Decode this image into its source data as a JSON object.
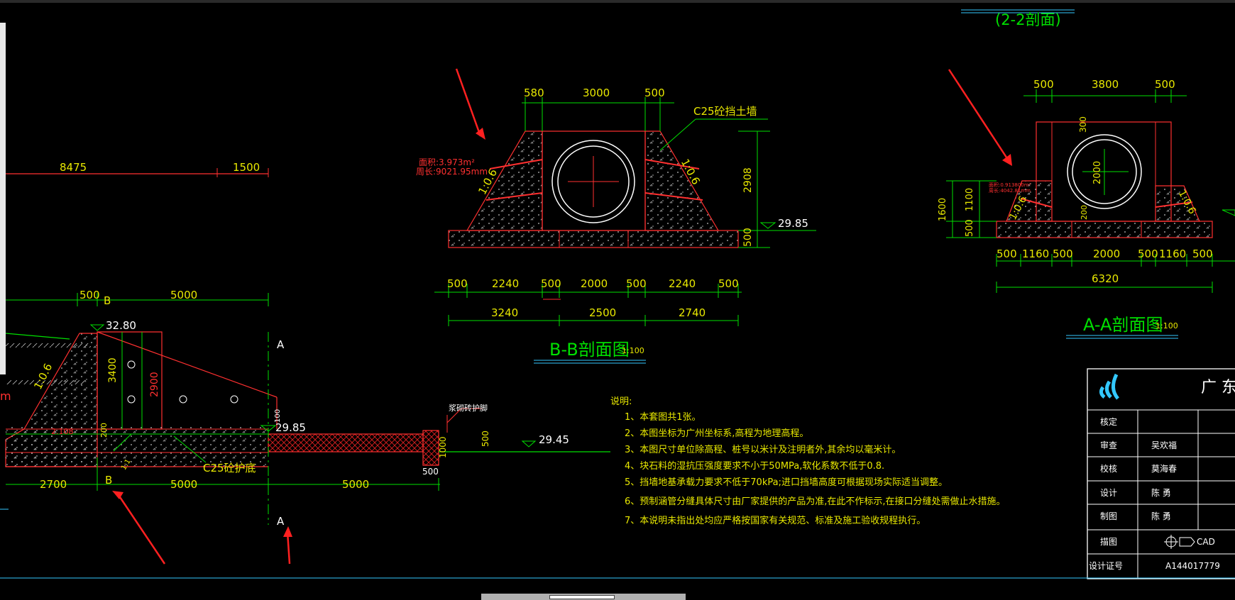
{
  "drawing": {
    "top_dims": {
      "d8475": "8475",
      "d1500": "1500"
    },
    "left": {
      "d500": "500",
      "labelB_top": "B",
      "d5000_top": "5000",
      "elev_3280": "32.80",
      "d3400": "3400",
      "d2900": "2900",
      "slope": "1:0.6",
      "d200": "200",
      "d2108": "2.108",
      "d100": "100",
      "elev_2985": "29.85",
      "labelA_top": "A",
      "labelA_bottom": "A",
      "d2700": "2700",
      "labelB_bottom": "B",
      "d5000_a": "5000",
      "d5000_b": "5000",
      "c25_floor": "C25砼护底",
      "d11": "1:1",
      "frag_m": "m",
      "endwall_label": "浆砌砖护脚",
      "d1000": "1000",
      "d500_b": "500",
      "d500_c": "500",
      "elev_2945": "29.45"
    },
    "bb": {
      "d580": "580",
      "d3000": "3000",
      "d500": "500",
      "wall_label": "C25砼挡土墙",
      "area": "面积:3.973m²",
      "perimeter": "周长:9021.95mm",
      "slope_l": "1:0.6",
      "slope_r": "1:0.6",
      "d2908": "2908",
      "elev": "29.85",
      "d500v": "500",
      "b1": "500",
      "b2": "2240",
      "b3": "500",
      "b4": "2000",
      "b5": "500",
      "b6": "2240",
      "b7": "500",
      "c1": "3240",
      "c2": "2500",
      "c3": "2740",
      "title": "B-B剖面图",
      "scale": "1:100"
    },
    "aa": {
      "frag_title": "(2-2剖面)",
      "t1": "500",
      "t2": "3800",
      "t3": "500",
      "d300": "300",
      "d2000": "2000",
      "d1100": "1100",
      "d1600": "1600",
      "d500": "500",
      "d200": "200",
      "slope_l": "1:0.6",
      "slope_r": "1:0.6",
      "area": "面积:0.913800m²",
      "perimeter": "周长:4042.81mm",
      "b1": "500",
      "b2": "1160",
      "b3": "500",
      "b4": "2000",
      "b5": "500",
      "b6": "1160",
      "b7": "500",
      "total": "6320",
      "title": "A-A剖面图",
      "scale": "1:100"
    },
    "notes": {
      "heading": "说明:",
      "items": [
        "1、本套图共1张。",
        "2、本图坐标为广州坐标系,高程为地理高程。",
        "3、本图尺寸单位除高程、桩号以米计及注明者外,其余均以毫米计。",
        "4、块石料的湿抗压强度要求不小于50MPa,软化系数不低于0.8.",
        "5、挡墙地基承载力要求不低于70kPa;进口挡墙高度可根据现场实际适当调整。",
        "6、预制涵管分缝具体尺寸由厂家提供的产品为准,在此不作标示,在接口分缝处需做止水措施。",
        "7、本说明未指出处均应严格按国家有关规范、标准及施工验收规程执行。"
      ]
    },
    "titleblock": {
      "company": "广 东",
      "rows": [
        {
          "label": "核定",
          "value": ""
        },
        {
          "label": "审查",
          "value": "吴欢福"
        },
        {
          "label": "校核",
          "value": "莫海春"
        },
        {
          "label": "设计",
          "value": "陈 勇"
        },
        {
          "label": "制图",
          "value": "陈 勇"
        },
        {
          "label": "描图",
          "value": "CAD"
        },
        {
          "label": "设计证号",
          "value": "A144017779"
        }
      ]
    }
  },
  "colors": {
    "green": "#00e000",
    "yellow": "#e8e800",
    "red": "#ff3030",
    "white": "#ffffff",
    "cyan": "#33c8ff",
    "background": "#000000"
  }
}
